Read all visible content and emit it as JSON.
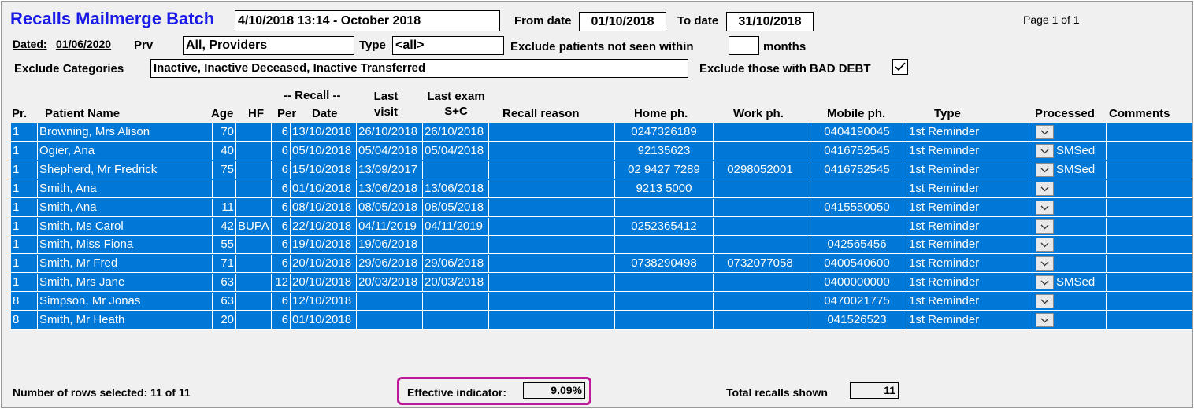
{
  "header": {
    "title": "Recalls Mailmerge Batch",
    "batch_name": "4/10/2018 13:14 - October 2018",
    "from_date_label": "From date",
    "from_date": "01/10/2018",
    "to_date_label": "To date",
    "to_date": "31/10/2018",
    "page": "Page 1 of 1",
    "dated_label": "Dated:",
    "dated_value": "01/06/2020",
    "prv_label": "Prv",
    "prv_value": "All,   Providers",
    "type_label": "Type",
    "type_value": "<all>",
    "exclude_not_seen_label": "Exclude patients not seen within",
    "exclude_not_seen_value": "",
    "months_label": "months",
    "exclude_categories_label": "Exclude Categories",
    "exclude_categories_value": "Inactive, Inactive Deceased, Inactive Transferred",
    "bad_debt_label": "Exclude those with BAD DEBT",
    "bad_debt_checked": true
  },
  "columns": {
    "pr": "Pr.",
    "patient_name": "Patient Name",
    "age": "Age",
    "hf": "HF",
    "recall_group": "-- Recall --",
    "per": "Per",
    "date": "Date",
    "last_visit_1": "Last",
    "last_visit_2": "visit",
    "last_exam_1": "Last exam",
    "last_exam_2": "S+C",
    "recall_reason": "Recall reason",
    "home_ph": "Home ph.",
    "work_ph": "Work ph.",
    "mobile_ph": "Mobile ph.",
    "type": "Type",
    "processed": "Processed",
    "comments": "Comments"
  },
  "rows": [
    {
      "pr": "1",
      "name": "Browning, Mrs Alison",
      "age": "70",
      "hf": "",
      "per": "6",
      "date": "13/10/2018",
      "last_visit": "26/10/2018",
      "last_exam": "26/10/2018",
      "reason": "",
      "home": "0247326189",
      "work": "",
      "mobile": "0404190045",
      "type": "1st Reminder",
      "processed": "",
      "comments": ""
    },
    {
      "pr": "1",
      "name": "Ogier,  Ana",
      "age": "40",
      "hf": "",
      "per": "6",
      "date": "05/10/2018",
      "last_visit": "05/04/2018",
      "last_exam": "05/04/2018",
      "reason": "",
      "home": "92135623",
      "work": "",
      "mobile": "0416752545",
      "type": "1st Reminder",
      "processed": "SMSed",
      "comments": ""
    },
    {
      "pr": "1",
      "name": "Shepherd, Mr Fredrick",
      "age": "75",
      "hf": "",
      "per": "6",
      "date": "15/10/2018",
      "last_visit": "13/09/2017",
      "last_exam": "",
      "reason": "",
      "home": "02 9427 7289",
      "work": "0298052001",
      "mobile": "0416752545",
      "type": "1st Reminder",
      "processed": "SMSed",
      "comments": ""
    },
    {
      "pr": "1",
      "name": "Smith,  Ana",
      "age": "",
      "hf": "",
      "per": "6",
      "date": "01/10/2018",
      "last_visit": "13/06/2018",
      "last_exam": "13/06/2018",
      "reason": "",
      "home": "9213 5000",
      "work": "",
      "mobile": "",
      "type": "1st Reminder",
      "processed": "",
      "comments": ""
    },
    {
      "pr": "1",
      "name": "Smith,  Ana",
      "age": "11",
      "hf": "",
      "per": "6",
      "date": "08/10/2018",
      "last_visit": "08/05/2018",
      "last_exam": "08/05/2018",
      "reason": "",
      "home": "",
      "work": "",
      "mobile": "0415550050",
      "type": "1st Reminder",
      "processed": "",
      "comments": ""
    },
    {
      "pr": "1",
      "name": "Smith, Ms Carol",
      "age": "42",
      "hf": "BUPA",
      "per": "6",
      "date": "22/10/2018",
      "last_visit": "04/11/2019",
      "last_exam": "04/11/2019",
      "reason": "",
      "home": "0252365412",
      "work": "",
      "mobile": "",
      "type": "1st Reminder",
      "processed": "",
      "comments": ""
    },
    {
      "pr": "1",
      "name": "Smith, Miss Fiona",
      "age": "55",
      "hf": "",
      "per": "6",
      "date": "19/10/2018",
      "last_visit": "19/06/2018",
      "last_exam": "",
      "reason": "",
      "home": "",
      "work": "",
      "mobile": "042565456",
      "type": "1st Reminder",
      "processed": "",
      "comments": ""
    },
    {
      "pr": "1",
      "name": "Smith, Mr Fred",
      "age": "71",
      "hf": "",
      "per": "6",
      "date": "20/10/2018",
      "last_visit": "29/06/2018",
      "last_exam": "29/06/2018",
      "reason": "",
      "home": "0738290498",
      "work": "0732077058",
      "mobile": "0400540600",
      "type": "1st Reminder",
      "processed": "",
      "comments": ""
    },
    {
      "pr": "1",
      "name": "Smith, Mrs Jane",
      "age": "63",
      "hf": "",
      "per": "12",
      "date": "20/10/2018",
      "last_visit": "20/03/2018",
      "last_exam": "20/03/2018",
      "reason": "",
      "home": "",
      "work": "",
      "mobile": "0400000000",
      "type": "1st Reminder",
      "processed": "SMSed",
      "comments": ""
    },
    {
      "pr": "8",
      "name": "Simpson, Mr Jonas",
      "age": "63",
      "hf": "",
      "per": "6",
      "date": "12/10/2018",
      "last_visit": "",
      "last_exam": "",
      "reason": "",
      "home": "",
      "work": "",
      "mobile": "0470021775",
      "type": "1st Reminder",
      "processed": "",
      "comments": ""
    },
    {
      "pr": "8",
      "name": "Smith, Mr Heath",
      "age": "20",
      "hf": "",
      "per": "6",
      "date": "01/10/2018",
      "last_visit": "",
      "last_exam": "",
      "reason": "",
      "home": "",
      "work": "",
      "mobile": "041526523",
      "type": "1st Reminder",
      "processed": "",
      "comments": ""
    }
  ],
  "footer": {
    "rows_selected": "Number of rows selected: 11 of 11",
    "effective_label": "Effective indicator:",
    "effective_value": "9.09%",
    "total_label": "Total recalls shown",
    "total_value": "11"
  },
  "colors": {
    "row_selected_bg": "#0078d7",
    "title": "#1a1ae6",
    "highlight": "#c0189a"
  }
}
